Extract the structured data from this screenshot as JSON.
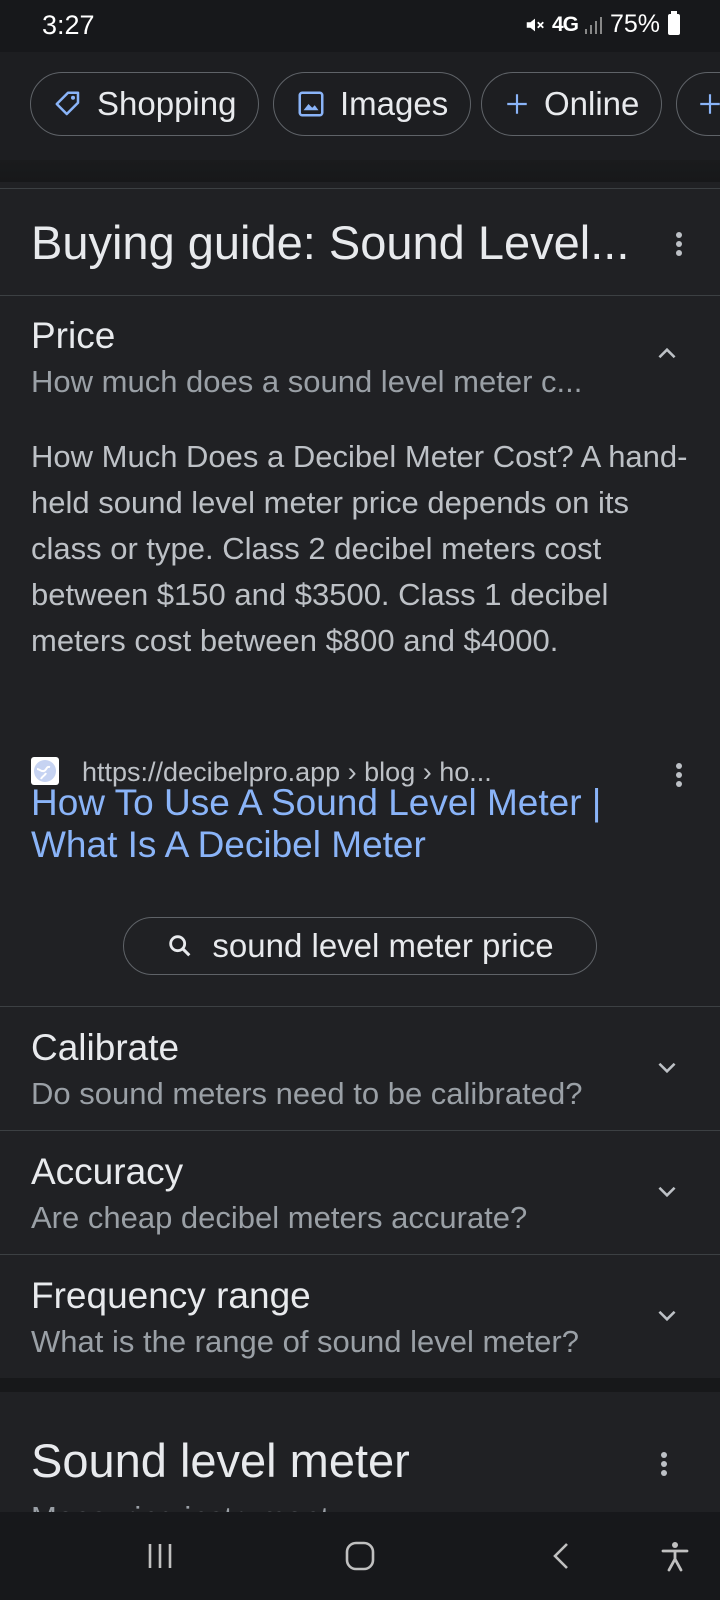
{
  "status_bar": {
    "time": "3:27",
    "network": "4G",
    "battery": "75%"
  },
  "filter_chips": [
    {
      "label": "Shopping",
      "icon": "tag-icon"
    },
    {
      "label": "Images",
      "icon": "image-icon"
    },
    {
      "label": "Online",
      "icon": "plus-icon"
    }
  ],
  "buying_guide": {
    "title": "Buying guide: Sound Level...",
    "sections": [
      {
        "title": "Price",
        "question": "How much does a sound level meter c...",
        "expanded": true
      },
      {
        "title": "Calibrate",
        "question": "Do sound meters need to be calibrated?",
        "expanded": false
      },
      {
        "title": "Accuracy",
        "question": "Are cheap decibel meters accurate?",
        "expanded": false
      },
      {
        "title": "Frequency range",
        "question": "What is the range of sound level meter?",
        "expanded": false
      }
    ],
    "answer": {
      "text": "How Much Does a Decibel Meter Cost? A hand-held sound level meter price depends on its class or type. Class 2 decibel meters cost between $150 and $3500. Class 1 decibel meters cost between $800 and $4000.",
      "source_url": "https://decibelpro.app › blog › ho...",
      "link_title": "How To Use A Sound Level Meter | What Is A Decibel Meter",
      "search_suggestion": "sound level meter price"
    }
  },
  "knowledge_panel": {
    "title": "Sound level meter",
    "subtitle": "Measuring instrument"
  },
  "colors": {
    "background": "#202124",
    "link": "#8ab4f8",
    "text_primary": "#e8eaed",
    "text_secondary": "#9aa0a6",
    "border": "#3c4043"
  }
}
